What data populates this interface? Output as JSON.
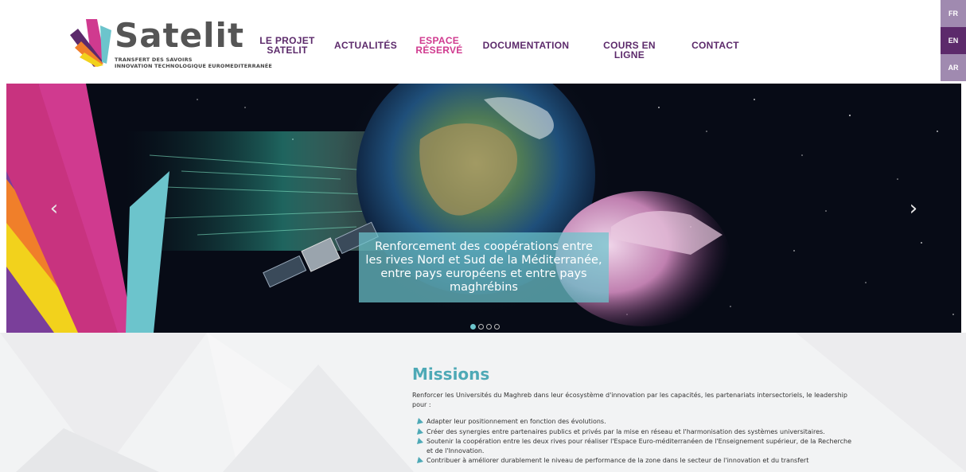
{
  "logo": {
    "name": "Satelit",
    "tagline_line1": "TRANSFERT DES SAVOIRS",
    "tagline_line2": "INNOVATION TECHNOLOGIQUE EUROMEDITERRANÉE"
  },
  "nav": {
    "items": [
      {
        "line1": "LE PROJET",
        "line2": "SATELIT"
      },
      {
        "line1": "ACTUALITÉS",
        "line2": ""
      },
      {
        "line1": "ESPACE",
        "line2": "RÉSERVÉ"
      },
      {
        "line1": "DOCUMENTATION",
        "line2": ""
      },
      {
        "line1": "COURS EN LIGNE",
        "line2": ""
      },
      {
        "line1": "CONTACT",
        "line2": ""
      }
    ]
  },
  "languages": [
    {
      "label": "FR",
      "color": "#a08ab0"
    },
    {
      "label": "EN",
      "color": "#5c2a6b"
    },
    {
      "label": "AR",
      "color": "#a08ab0"
    }
  ],
  "hero": {
    "caption": "Renforcement des coopérations entre les rives Nord et Sud de la Méditerranée, entre pays européens et entre pays maghrébins",
    "prev_icon": "chevron-left-icon",
    "next_icon": "chevron-right-icon",
    "slide_count": 4,
    "active_slide": 1
  },
  "missions": {
    "title": "Missions",
    "intro": "Renforcer les Universités du Maghreb dans leur écosystème d'innovation par les capacités, les partenariats intersectoriels, le leadership pour :",
    "items": [
      "Adapter leur positionnement en fonction des évolutions.",
      "Créer des synergies entre partenaires publics et privés par la mise en réseau et l'harmonisation des systèmes universitaires.",
      "Soutenir la coopération entre les deux rives pour réaliser l'Espace Euro-méditerranéen de l'Enseignement supérieur, de la Recherche et de l'Innovation.",
      "Contribuer à améliorer durablement le niveau de performance de la zone dans le secteur de l'innovation et du transfert"
    ]
  },
  "colors": {
    "brand_purple": "#5c2a6b",
    "brand_pink": "#d03a8f",
    "brand_teal": "#4ea9b6",
    "nav_active": "#d03a8f"
  }
}
